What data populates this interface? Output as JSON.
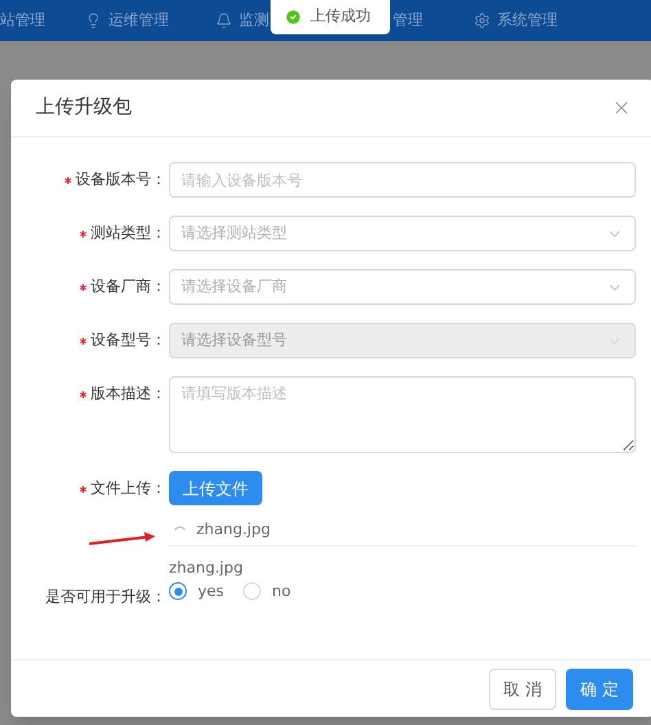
{
  "nav": [
    {
      "label": "站管理"
    },
    {
      "label": "运维管理"
    },
    {
      "label": "监测"
    },
    {
      "label": "管理"
    },
    {
      "label": "系统管理"
    }
  ],
  "toast": {
    "text": "上传成功",
    "kind": "success"
  },
  "dialog": {
    "title": "上传升级包",
    "fields": [
      {
        "kind": "input",
        "label": "设备版本号：",
        "required": true,
        "placeholder": "请输入设备版本号"
      },
      {
        "kind": "select",
        "label": "测站类型：",
        "required": true,
        "placeholder": "请选择测站类型",
        "disabled": false
      },
      {
        "kind": "select",
        "label": "设备厂商：",
        "required": true,
        "placeholder": "请选择设备厂商",
        "disabled": false
      },
      {
        "kind": "select",
        "label": "设备型号：",
        "required": true,
        "placeholder": "请选择设备型号",
        "disabled": true
      },
      {
        "kind": "textarea",
        "label": "版本描述：",
        "required": true,
        "placeholder": "请填写版本描述"
      },
      {
        "kind": "upload",
        "label": "文件上传：",
        "required": true,
        "button": "上传文件",
        "files": [
          {
            "name": "zhang.jpg",
            "uploading": true
          }
        ],
        "note": "zhang.jpg"
      },
      {
        "kind": "radio",
        "label": "是否可用于升级：",
        "required": false,
        "options": [
          {
            "label": "yes",
            "selected": true
          },
          {
            "label": "no",
            "selected": false
          }
        ]
      }
    ],
    "buttons": [
      {
        "label": "取 消",
        "primary": false
      },
      {
        "label": "确 定",
        "primary": true
      }
    ]
  }
}
